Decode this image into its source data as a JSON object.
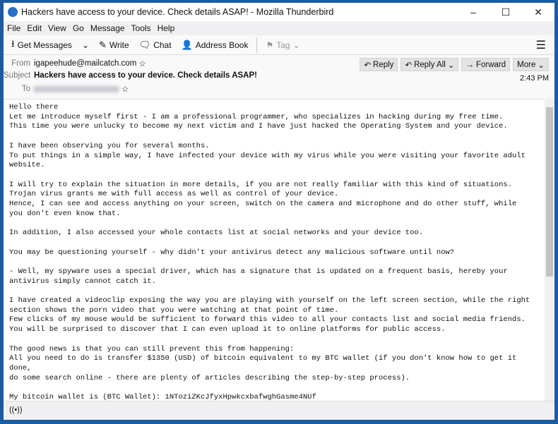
{
  "window": {
    "title": "Hackers have access to your device. Check details ASAP! - Mozilla Thunderbird"
  },
  "menu": [
    "File",
    "Edit",
    "View",
    "Go",
    "Message",
    "Tools",
    "Help"
  ],
  "toolbar": {
    "get_messages": "Get Messages",
    "write": "Write",
    "chat": "Chat",
    "address_book": "Address Book",
    "tag": "Tag"
  },
  "header": {
    "from_label": "From",
    "from": "igapeehude@mailcatch.com",
    "subject_label": "Subject",
    "subject": "Hackers have access to your device. Check details ASAP!",
    "to_label": "To",
    "time": "2:43 PM"
  },
  "actions": {
    "reply": "Reply",
    "reply_all": "Reply All",
    "forward": "Forward",
    "more": "More"
  },
  "body": "Hello there\nLet me introduce myself first - I am a professional programmer, who specializes in hacking during my free time.\nThis time you were unlucky to become my next victim and I have just hacked the Operating System and your device.\n\nI have been observing you for several months.\nTo put things in a simple way, I have infected your device with my virus while you were visiting your favorite adult\nwebsite.\n\nI will try to explain the situation in more details, if you are not really familiar with this kind of situations.\nTrojan virus grants me with full access as well as control of your device.\nHence, I can see and access anything on your screen, switch on the camera and microphone and do other stuff, while\nyou don't even know that.\n\nIn addition, I also accessed your whole contacts list at social networks and your device too.\n\nYou may be questioning yourself - why didn't your antivirus detect any malicious software until now?\n\n- Well, my spyware uses a special driver, which has a signature that is updated on a frequent basis, hereby your\nantivirus simply cannot catch it.\n\nI have created a videoclip exposing the way you are playing with yourself on the left screen section, while the right\nsection shows the porn video that you were watching at that point of time.\nFew clicks of my mouse would be sufficient to forward this video to all your contacts list and social media friends.\nYou will be surprised to discover that I can even upload it to online platforms for public access.\n\nThe good news is that you can still prevent this from happening:\nAll you need to do is transfer $1350 (USD) of bitcoin equivalent to my BTC wallet (if you don't know how to get it\ndone,\ndo some search online - there are plenty of articles describing the step-by-step process).\n\nMy bitcoin wallet is (BTC Wallet): 1NToziZKcJfyxHpwkcxbafwghGasme4NUf"
}
